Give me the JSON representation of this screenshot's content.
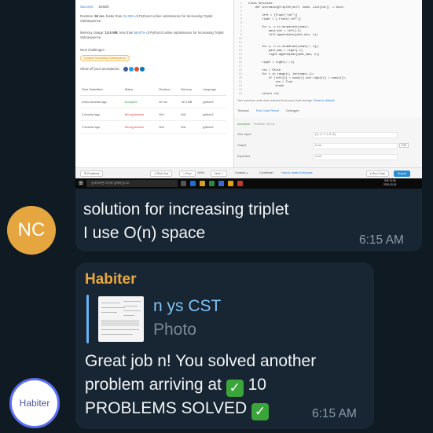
{
  "screenshot": {
    "tabs": [
      "Success",
      "Details"
    ],
    "runtime_prefix": "Runtime:",
    "runtime_value": "60 ms",
    "runtime_mid": ", faster than",
    "runtime_pct": "31.05%",
    "runtime_suffix": "of Python3 online submissions for Increasing Triplet Subsequence.",
    "memory_prefix": "Memory Usage:",
    "memory_value": "13.5 MB",
    "memory_mid": ", less than",
    "memory_pct": "66.67%",
    "memory_suffix": "of Python3 online submissions for Increasing Triplet Subsequence.",
    "next_challenges": "Next challenges:",
    "challenge_tag": "Longest Increasing Subsequence",
    "share_label": "Show off your acceptance:",
    "table": {
      "headers": [
        "Time Submitted",
        "Status",
        "Runtime",
        "Memory",
        "Language"
      ],
      "rows": [
        [
          "a few seconds ago",
          "Accepted",
          "60 ms",
          "13.5 MB",
          "python3"
        ],
        [
          "2 months ago",
          "Wrong Answer",
          "N/A",
          "N/A",
          "python3"
        ],
        [
          "2 months ago",
          "Wrong Answer",
          "N/A",
          "N/A",
          "python3"
        ]
      ]
    },
    "code": [
      "class Solution:",
      "    def increasingTriplet(self, nums: List[int]) -> bool:",
      "",
      "        left = [float('inf')]",
      "        right = [-float('inf')]",
      "",
      "        for x, n in enumerate(nums):",
      "            past_min = left[-1]",
      "            left.append(min(past_min, n))",
      "",
      "",
      "        for x, n in enumerate(nums[::-1]):",
      "            past_max = right[-1]",
      "            right.append(max(past_max, n))",
      "",
      "        right = right[::-1]",
      "",
      "        res = False",
      "        for i in range(1, len(nums)-1):",
      "            if (left[i] < nums[i] and right[i] > nums[i]):",
      "                res = True",
      "                break",
      "",
      "        return res"
    ],
    "storage_note": "Your previous code was restored from your local storage.",
    "storage_link": "Reset to default",
    "console_tabs": [
      "Testcase",
      "Run Code Result",
      "Debugger"
    ],
    "result_status": "Accepted",
    "result_runtime": "Runtime: 48 ms",
    "your_input_label": "Your input",
    "your_input_value": "[5,4,7,1,6,8]",
    "output_label": "Output",
    "output_value": "true",
    "expected_label": "Expected",
    "expected_value": "true",
    "diff_label": "Diff",
    "bottom": {
      "problems": "☰ Problems",
      "pick_one": "⤭ Pick One",
      "prev": "< Prev",
      "page": "16/54",
      "next": "Next >",
      "console": "Console ▴",
      "contribute": "Contribute i",
      "how_to": "How to create a testcase",
      "run_code": "▸ Run Code",
      "submit": "Submit"
    },
    "taskbar_search": "검색하려면 여기에 입력하십시오.",
    "clock_time": "오후 10:55",
    "clock_date": "2020-03-18"
  },
  "message1": {
    "avatar_initials": "NC",
    "line1": "solution for increasing triplet",
    "line2": "I use O(n) space",
    "time": "6:15 AM"
  },
  "message2": {
    "sender": "Habiter",
    "quote_name": "n ys CST",
    "quote_sub": "Photo",
    "line1": "Great job n! You solved another",
    "line2a": "problem arriving at",
    "line2b": "10",
    "line3": "PROBLEMS SOLVED",
    "check_glyph": "✓",
    "time": "6:15 AM",
    "avatar_text": "Habiter"
  },
  "colors": {
    "chat_bg": "#101a23",
    "bubble_bg": "#182533",
    "nc_avatar": "#e5a640",
    "sender_name": "#e8a73f",
    "quote_bar": "#6ab2f2",
    "timestamp": "#8a9aab",
    "check_badge": "#3aa53a"
  }
}
